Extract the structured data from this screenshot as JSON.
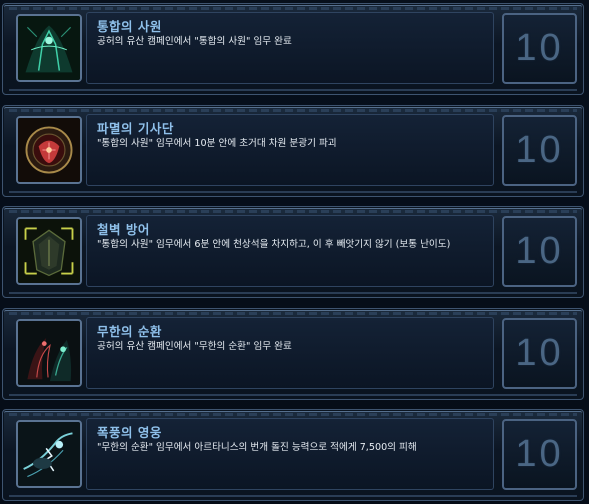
{
  "achievements": [
    {
      "title": "통합의 사원",
      "description": "공허의 유산 캠페인에서 \"통합의 사원\" 임무 완료",
      "points": "10",
      "icon": "temple-warrior-icon",
      "accent": "#3fd0a8"
    },
    {
      "title": "파멸의 기사단",
      "description": "\"통합의 사원\" 임무에서 10분 안에 초거대 차원 분광기 파괴",
      "points": "10",
      "icon": "knight-emblem-icon",
      "accent": "#d04848"
    },
    {
      "title": "철벽 방어",
      "description": "\"통합의 사원\" 임무에서 6분 안에 천상석을 차지하고, 이 후 빼앗기지 않기 (보통 난이도)",
      "points": "10",
      "icon": "shield-crystal-icon",
      "accent": "#c8d04a"
    },
    {
      "title": "무한의 순환",
      "description": "공허의 유산 캠페인에서 \"무한의 순환\" 임무 완료",
      "points": "10",
      "icon": "dark-archon-icon",
      "accent": "#3aa890"
    },
    {
      "title": "폭풍의 영웅",
      "description": "\"무한의 순환\" 임무에서 아르타니스의 번개 돌진 능력으로 적에게 7,500의 피해",
      "points": "10",
      "icon": "lightning-hero-icon",
      "accent": "#7ad0d8"
    }
  ]
}
